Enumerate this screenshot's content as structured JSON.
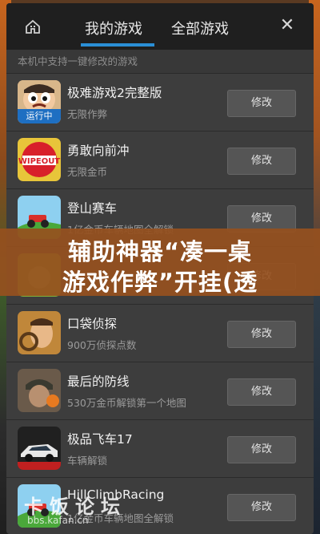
{
  "header": {
    "tab_mine": "我的游戏",
    "tab_all": "全部游戏",
    "home_icon": "home-icon",
    "close_icon": "close-icon",
    "accent_color": "#2a8fd6"
  },
  "subheader": "本机中支持一键修改的游戏",
  "games": [
    {
      "title": "极难游戏2完整版",
      "subtitle": "无限作弊",
      "button": "修改",
      "badge": "运行中",
      "icon": "angry-face-icon"
    },
    {
      "title": "勇敢向前冲",
      "subtitle": "无限金币",
      "button": "修改",
      "icon": "wipeout-icon"
    },
    {
      "title": "登山赛车",
      "subtitle": "1亿金币车辆地图全解锁",
      "button": "修改",
      "icon": "hill-car-icon"
    },
    {
      "title": "",
      "subtitle": "",
      "button": "修改",
      "icon": "green-game-icon"
    },
    {
      "title": "口袋侦探",
      "subtitle": "900万侦探点数",
      "button": "修改",
      "icon": "detective-icon"
    },
    {
      "title": "最后的防线",
      "subtitle": "530万金币解锁第一个地图",
      "button": "修改",
      "icon": "soldier-icon"
    },
    {
      "title": "极品飞车17",
      "subtitle": "车辆解锁",
      "button": "修改",
      "icon": "race-car-icon"
    },
    {
      "title": "HillClimbRacing",
      "subtitle": "1亿金币车辆地图全解锁",
      "button": "修改",
      "icon": "hill-car-icon"
    }
  ],
  "banner": {
    "line1": "辅助神器“凑一桌",
    "line2": "游戏作弊”开挂(透"
  },
  "watermark": {
    "text": "卡饭论坛",
    "url": "bbs.kafan.cn"
  }
}
